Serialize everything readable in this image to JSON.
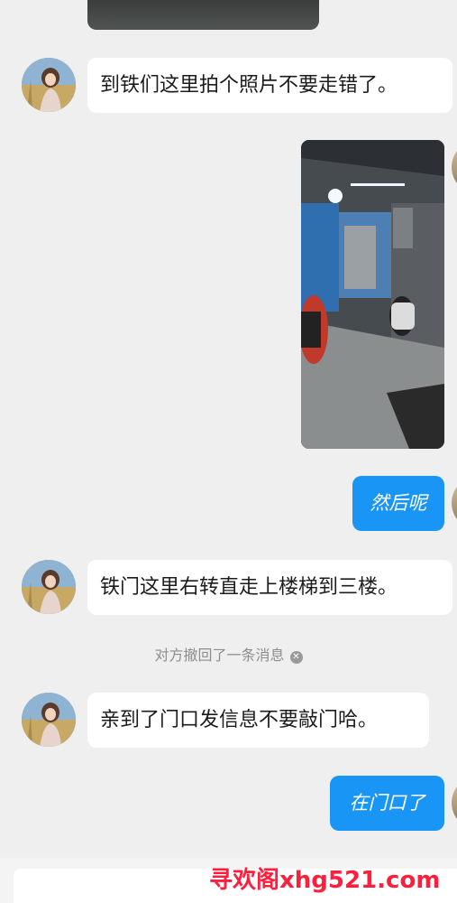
{
  "messages": {
    "m1": "到铁们这里拍个照片不要走错了。",
    "m2": "然后呢",
    "m3": "铁门这里右转直走上楼梯到三楼。",
    "m4": "亲到了门口发信息不要敲门哈。",
    "m5": "在门口了"
  },
  "system": {
    "recall_notice": "对方撤回了一条消息",
    "close_glyph": "✕"
  },
  "watermark": {
    "text": "寻欢阁xhg521.com"
  },
  "colors": {
    "outgoing_bubble": "#1996f5",
    "incoming_bubble": "#ffffff",
    "background": "#efefef",
    "watermark": "#ff1f3d"
  }
}
